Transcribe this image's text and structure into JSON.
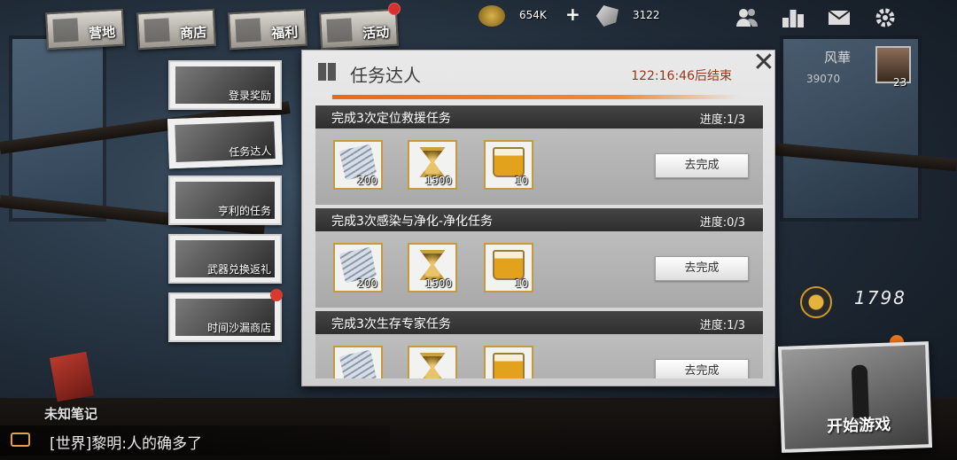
{
  "top_tabs": [
    {
      "label": "营地",
      "icon": "camp-icon"
    },
    {
      "label": "商店",
      "icon": "shop-icon"
    },
    {
      "label": "福利",
      "icon": "welfare-icon"
    },
    {
      "label": "活动",
      "icon": "event-icon"
    }
  ],
  "resources": {
    "coins": "654K",
    "plus": "+",
    "gems": "3122"
  },
  "top_icons": [
    "friends-icon",
    "ranking-icon",
    "mail-icon",
    "settings-icon"
  ],
  "nav": [
    {
      "label": "登录奖励"
    },
    {
      "label": "任务达人"
    },
    {
      "label": "亨利的任务"
    },
    {
      "label": "武器兑换返礼"
    },
    {
      "label": "时间沙漏商店"
    }
  ],
  "panel": {
    "title": "任务达人",
    "timer": "122:16:46后结束",
    "close": "✕"
  },
  "tasks": [
    {
      "title": "完成3次定位救援任务",
      "progress": "进度:1/3",
      "rewards": [
        {
          "icon": "cash-icon",
          "qty": "200"
        },
        {
          "icon": "hourglass-icon",
          "qty": "1500"
        },
        {
          "icon": "beer-icon",
          "qty": "10"
        }
      ],
      "button": "去完成"
    },
    {
      "title": "完成3次感染与净化-净化任务",
      "progress": "进度:0/3",
      "rewards": [
        {
          "icon": "cash-icon",
          "qty": "200"
        },
        {
          "icon": "hourglass-icon",
          "qty": "1500"
        },
        {
          "icon": "beer-icon",
          "qty": "10"
        }
      ],
      "button": "去完成"
    },
    {
      "title": "完成3次生存专家任务",
      "progress": "进度:1/3",
      "rewards": [
        {
          "icon": "cash-icon",
          "qty": ""
        },
        {
          "icon": "hourglass-icon",
          "qty": ""
        },
        {
          "icon": "beer-icon",
          "qty": ""
        }
      ],
      "button": "去完成"
    }
  ],
  "player": {
    "name": "风華",
    "score": "39070",
    "level": "23"
  },
  "badge_value": "1798",
  "start_button": "开始游戏",
  "notebook_label": "未知笔记",
  "chat": {
    "message": "[世界]黎明:人的确多了"
  },
  "colors": {
    "accent": "#e86a18",
    "timer": "#9a3414",
    "reward_border": "#c69a3c",
    "notify": "#d9302f"
  }
}
